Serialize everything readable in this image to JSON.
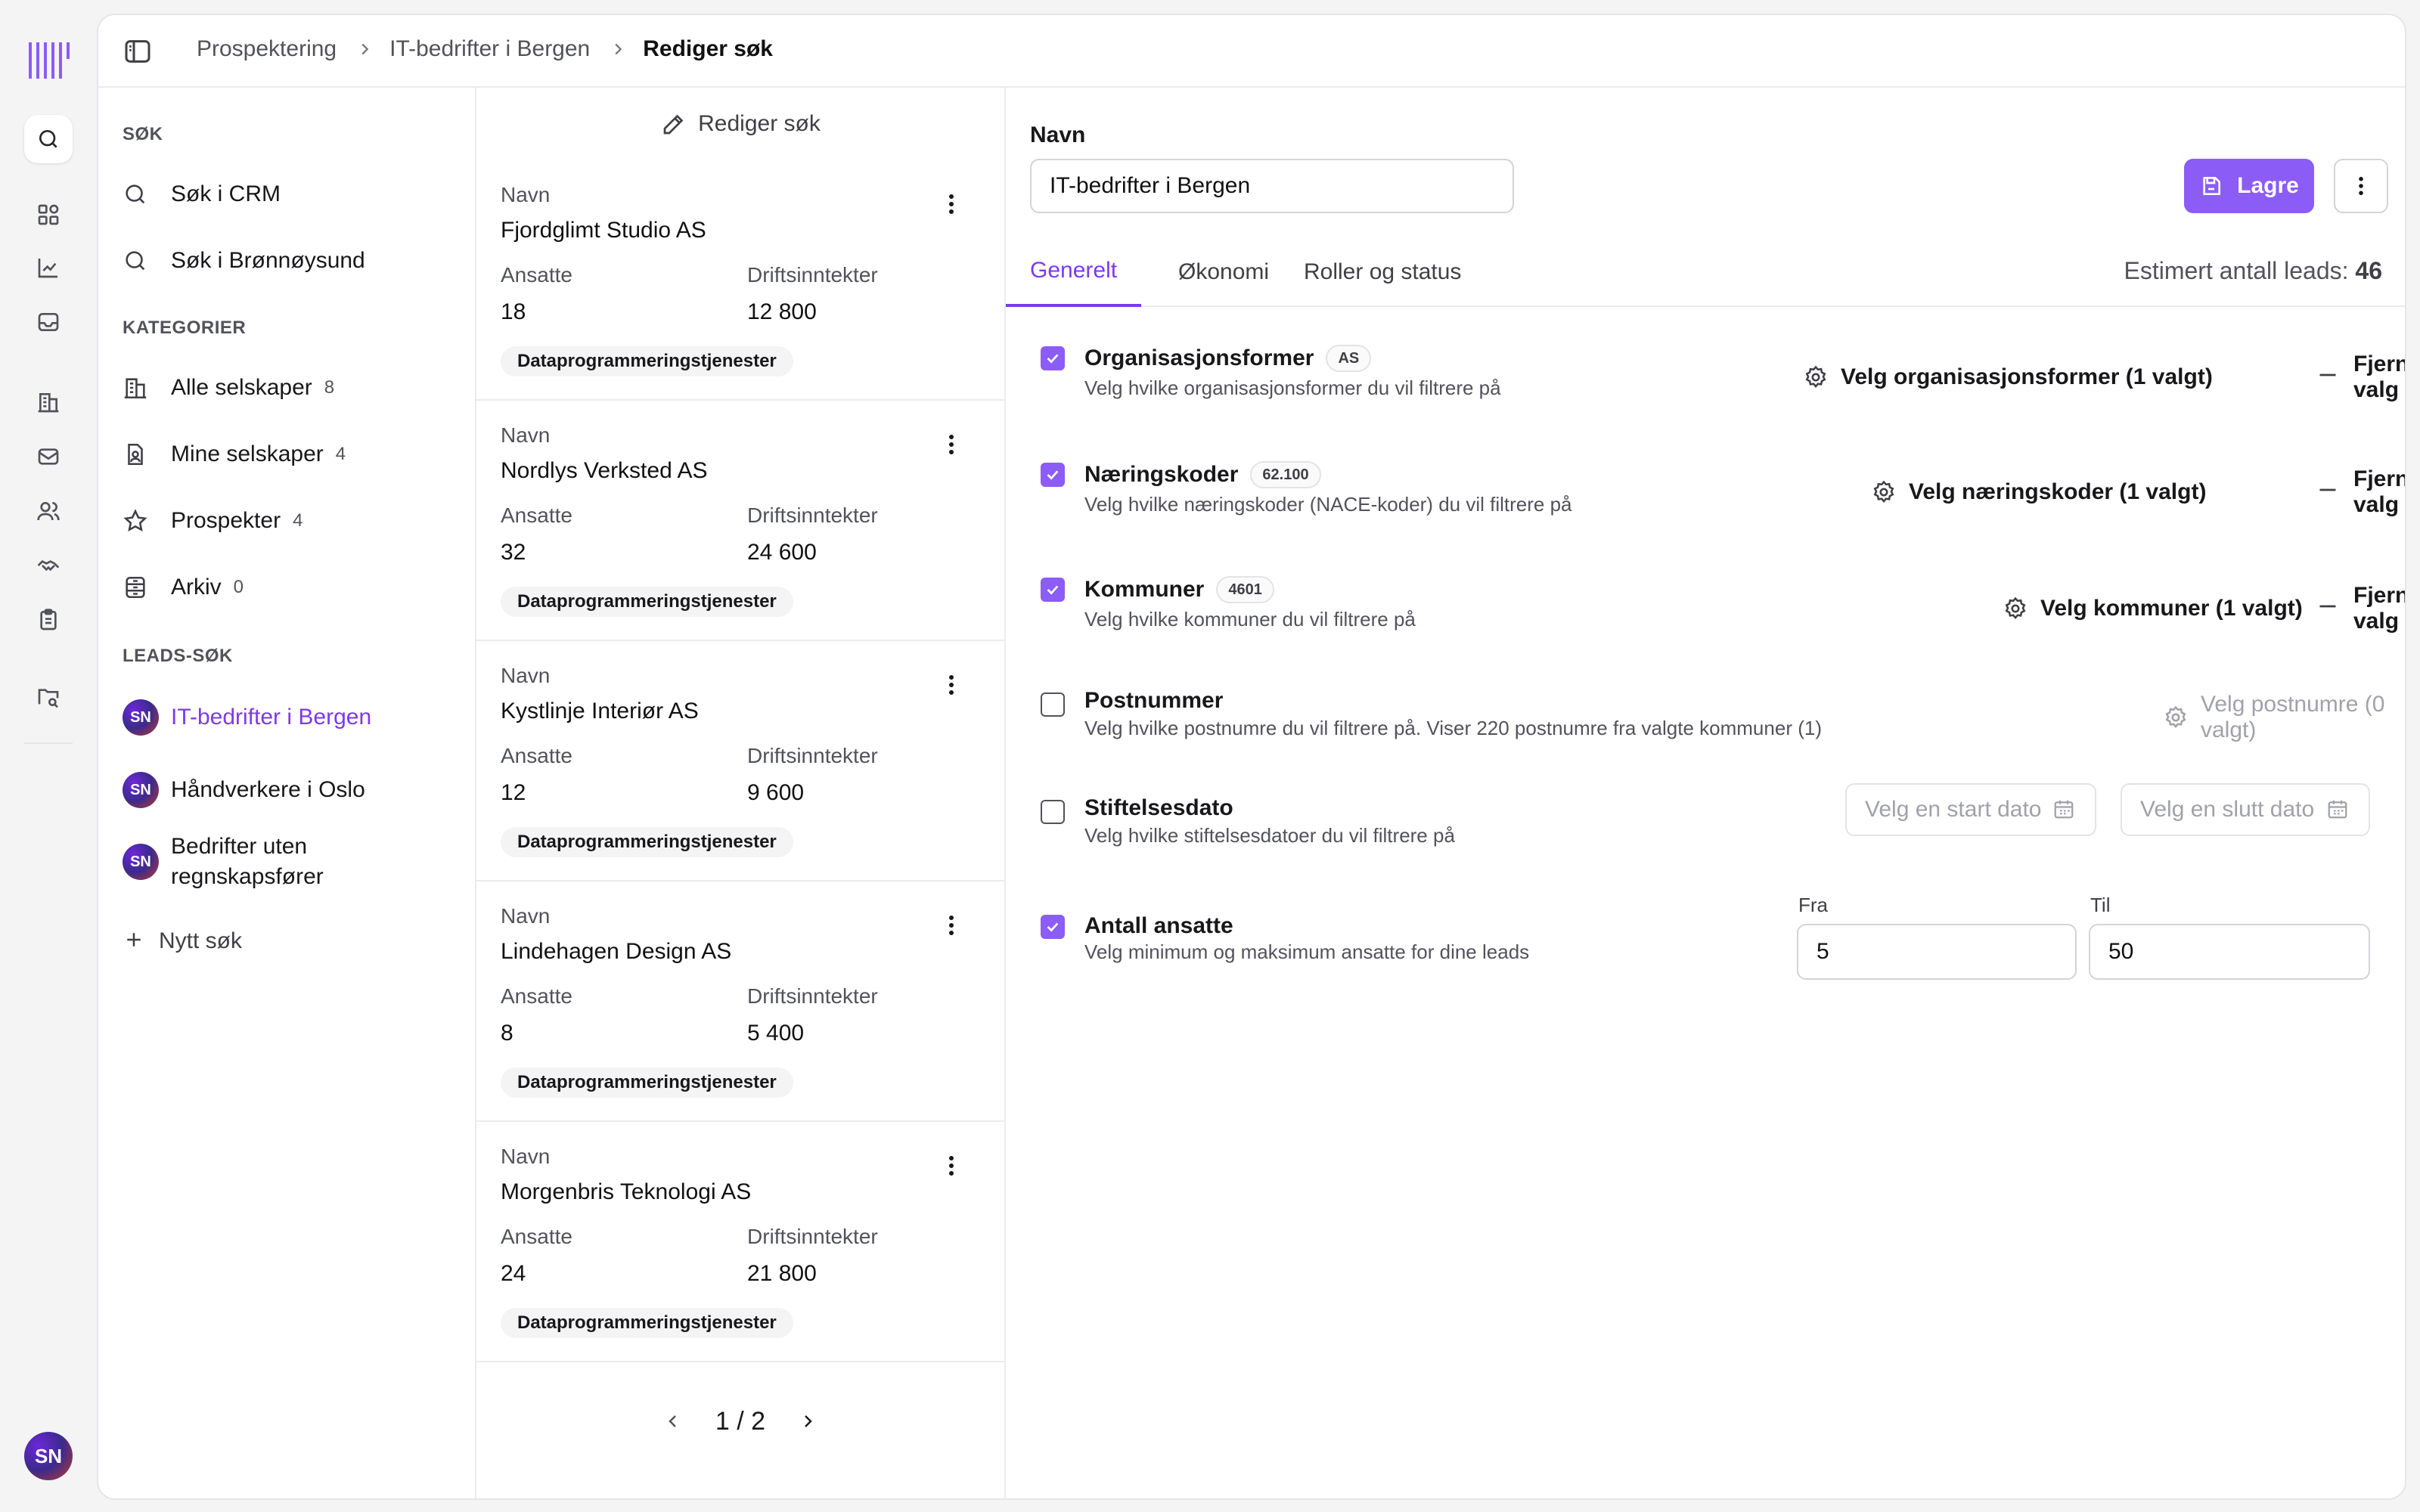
{
  "breadcrumb": {
    "items": [
      "Prospektering",
      "IT-bedrifter i Bergen"
    ],
    "current": "Rediger søk"
  },
  "nav": {
    "search_section": "SØK",
    "search_items": [
      "Søk i CRM",
      "Søk i Brønnøysund"
    ],
    "categories_section": "KATEGORIER",
    "categories": [
      {
        "label": "Alle selskaper",
        "count": "8"
      },
      {
        "label": "Mine selskaper",
        "count": "4"
      },
      {
        "label": "Prospekter",
        "count": "4"
      },
      {
        "label": "Arkiv",
        "count": "0"
      }
    ],
    "leads_section": "LEADS-SØK",
    "leads": [
      {
        "initials": "SN",
        "label": "IT-bedrifter i Bergen"
      },
      {
        "initials": "SN",
        "label": "Håndverkere i Oslo"
      },
      {
        "initials": "SN",
        "label": "Bedrifter uten regnskapsfører"
      }
    ],
    "new_search": "Nytt søk"
  },
  "rail": {
    "avatar_initials": "SN"
  },
  "results": {
    "header": "Rediger søk",
    "name_label": "Navn",
    "employees_label": "Ansatte",
    "revenue_label": "Driftsinntekter",
    "cards": [
      {
        "name": "Fjordglimt Studio AS",
        "employees": "18",
        "revenue": "12 800",
        "tag": "Dataprogrammeringstjenester"
      },
      {
        "name": "Nordlys Verksted AS",
        "employees": "32",
        "revenue": "24 600",
        "tag": "Dataprogrammeringstjenester"
      },
      {
        "name": "Kystlinje Interiør AS",
        "employees": "12",
        "revenue": "9 600",
        "tag": "Dataprogrammeringstjenester"
      },
      {
        "name": "Lindehagen Design AS",
        "employees": "8",
        "revenue": "5 400",
        "tag": "Dataprogrammeringstjenester"
      },
      {
        "name": "Morgenbris Teknologi AS",
        "employees": "24",
        "revenue": "21 800",
        "tag": "Dataprogrammeringstjenester"
      }
    ],
    "pager": "1 / 2"
  },
  "editor": {
    "name_label": "Navn",
    "name_value": "IT-bedrifter i Bergen",
    "save_label": "Lagre",
    "tabs": [
      "Generelt",
      "Økonomi",
      "Roller og status"
    ],
    "active_tab": "Generelt",
    "estimate_label": "Estimert antall leads:",
    "estimate_value": "46",
    "remove_label": "Fjern valg",
    "filters": {
      "org": {
        "checked": true,
        "title": "Organisasjonsformer",
        "badge": "AS",
        "desc": "Velg hvilke organisasjonsformer du vil filtrere på",
        "action": "Velg organisasjonsformer (1 valgt)"
      },
      "nace": {
        "checked": true,
        "title": "Næringskoder",
        "badge": "62.100",
        "desc": "Velg hvilke næringskoder (NACE-koder) du vil filtrere på",
        "action": "Velg næringskoder (1 valgt)"
      },
      "kommuner": {
        "checked": true,
        "title": "Kommuner",
        "badge": "4601",
        "desc": "Velg hvilke kommuner du vil filtrere på",
        "action": "Velg kommuner (1 valgt)"
      },
      "postnummer": {
        "checked": false,
        "title": "Postnummer",
        "desc": "Velg hvilke postnumre du vil filtrere på. Viser 220 postnumre fra valgte kommuner (1)",
        "action": "Velg postnumre (0 valgt)"
      },
      "stiftelse": {
        "checked": false,
        "title": "Stiftelsesdato",
        "desc": "Velg hvilke stiftelsesdatoer du vil filtrere på",
        "start_placeholder": "Velg en start dato",
        "end_placeholder": "Velg en slutt dato"
      },
      "ansatte": {
        "checked": true,
        "title": "Antall ansatte",
        "desc": "Velg minimum og maksimum ansatte for dine leads",
        "from_label": "Fra",
        "from_value": "5",
        "to_label": "Til",
        "to_value": "50"
      }
    }
  },
  "colors": {
    "accent": "#8b5cf6",
    "accent_text": "#7c3aed"
  }
}
